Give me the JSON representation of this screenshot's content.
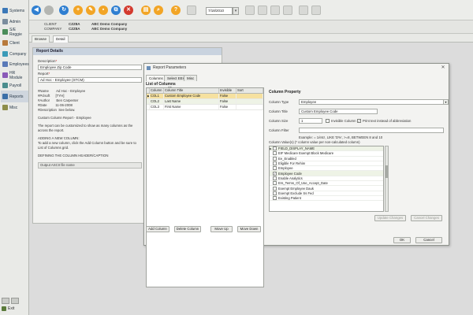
{
  "nav": {
    "items": [
      {
        "label": "Systems",
        "color": "#3b78b8"
      },
      {
        "label": "Admin",
        "color": "#7b8d9e"
      },
      {
        "label": "S/E Reggie",
        "color": "#4a8d5a"
      },
      {
        "label": "Client",
        "color": "#b87a3b"
      },
      {
        "label": "Company",
        "color": "#3b9bb8"
      },
      {
        "label": "Employees",
        "color": "#5a7ab8"
      },
      {
        "label": "HR Module",
        "color": "#8a5ab8"
      },
      {
        "label": "Payroll",
        "color": "#4a8d8d"
      },
      {
        "label": "Reports",
        "color": "#3b6fa8"
      },
      {
        "label": "Misc",
        "color": "#8d8d4a"
      }
    ],
    "active_index": 8,
    "exit_label": "Exit"
  },
  "toolbar": {
    "date": "7/18/2010",
    "date_btn": "▾"
  },
  "client_header": {
    "client_label": "CLIENT",
    "client_code": "CZZ8A",
    "client_name": "ABC Demo Company",
    "company_label": "COMPANY",
    "company_code": "CZZ8A",
    "company_name": "ABC Demo Company"
  },
  "page_tabs": [
    "Browse",
    "Detail"
  ],
  "report_details": {
    "title": "Report Details",
    "description_label": "Description",
    "description_value": "Employee Zip Code",
    "report_label": "Report",
    "report_value": "Ad Hoc - Employee (STCM)",
    "info_lines": "#Name        Ad Hoc - Employee\n#Pclsoft      [TYH]\n#Author       Ben Carpenter\n#Date         11-06-2008\n#Description  See below.",
    "custom_title": "Custom Column Report - Employee",
    "custom_desc": "The report can be customized to show as many columns as the\nacross the report.",
    "adding_title": "ADDING A NEW COLUMN:",
    "adding_desc": "To add a new column, click the Add Column button and be sure to\nList of Columns grid.",
    "defining_title": "DEFINING THE COLUMN HEADER/CAPTION",
    "output_hint": "Output ASCII file name"
  },
  "dialog": {
    "title": "Report Parameters",
    "close": "✕",
    "tabs": [
      "Columns",
      "Select EEs",
      "Misc"
    ],
    "list_title": "List of Columns",
    "grid": {
      "headers": [
        "Column",
        "Column Title",
        "Invisible",
        "Sort"
      ],
      "rows": [
        [
          "COL1",
          "Custom Employee Code",
          "False",
          ""
        ],
        [
          "COL2",
          "Last Name",
          "False",
          ""
        ],
        [
          "COL3",
          "First Name",
          "False",
          ""
        ]
      ]
    },
    "buttons": {
      "add_column": "Add Column",
      "delete_column": "Delete Column",
      "move_up": "Move Up",
      "move_down": "Move Down",
      "update_changes": "Update Changes",
      "cancel_changes": "Cancel Changes",
      "ok": "OK",
      "cancel": "Cancel"
    },
    "column_property": {
      "title": "Column Property",
      "column_type_label": "Column Type",
      "column_type_value": "Employee",
      "column_title_label": "Column Title",
      "column_title_value": "Custom Employee Code",
      "column_size_label": "Column Size",
      "column_size_value": "1",
      "invisible_label": "Invisible Column",
      "print_text_label": "Print text instead of abbreviation",
      "column_filter_label": "Column Filter",
      "example": "Example: = 1/etc!, LIKE 'D%', >=8, BETWEEN 8 and 10",
      "values_label": "Column Value(s) (* column value per non-calculated column)",
      "values": [
        {
          "text": "FIELD_DISPLAY_NAME",
          "checked": false,
          "head": true
        },
        {
          "text": "EIF Medicare Exempt Block Medicare",
          "checked": false
        },
        {
          "text": "Ee_Enabled",
          "checked": false
        },
        {
          "text": "Eligible For Rehire",
          "checked": false
        },
        {
          "text": "Employee",
          "checked": false
        },
        {
          "text": "Employee Code",
          "checked": true
        },
        {
          "text": "Enable Analytics",
          "checked": false
        },
        {
          "text": "Ers_Terms_Of_Use_Accept_Date",
          "checked": false
        },
        {
          "text": "Exempt Employee Dauk",
          "checked": false
        },
        {
          "text": "Exempt Exclude Ss Fed",
          "checked": false
        },
        {
          "text": "Existing Patient",
          "checked": false
        }
      ]
    }
  }
}
